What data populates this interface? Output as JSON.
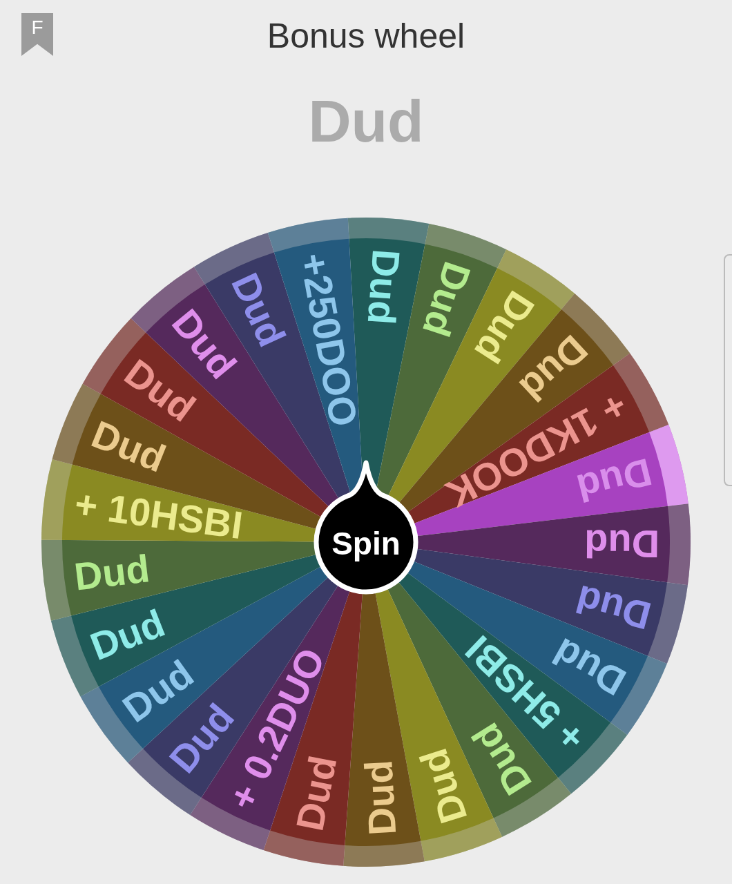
{
  "header": {
    "badge": "F",
    "title": "Bonus wheel"
  },
  "result": "Dud",
  "wheel": {
    "button": "Spin",
    "segments": [
      {
        "label": "Dud",
        "color": "#1f5a58",
        "selected": false
      },
      {
        "label": "Dud",
        "color": "#4d6a3a",
        "selected": false
      },
      {
        "label": "Dud",
        "color": "#8a8a22",
        "selected": false
      },
      {
        "label": "Dud",
        "color": "#6d5019",
        "selected": false
      },
      {
        "label": "+ 1KDOOK",
        "color": "#7a2a24",
        "selected": false
      },
      {
        "label": "Dud",
        "color": "#a742c0",
        "selected": true
      },
      {
        "label": "Dud",
        "color": "#55295c",
        "selected": false
      },
      {
        "label": "Dud",
        "color": "#3a3a66",
        "selected": false
      },
      {
        "label": "Dud",
        "color": "#245a7e",
        "selected": false
      },
      {
        "label": "+ 5HSBI",
        "color": "#1f5a58",
        "selected": false
      },
      {
        "label": "Dud",
        "color": "#4d6a3a",
        "selected": false
      },
      {
        "label": "Dud",
        "color": "#8a8a22",
        "selected": false
      },
      {
        "label": "Dud",
        "color": "#6d5019",
        "selected": false
      },
      {
        "label": "Dud",
        "color": "#7a2a24",
        "selected": false
      },
      {
        "label": "+ 0.2DUO",
        "color": "#55295c",
        "selected": false
      },
      {
        "label": "Dud",
        "color": "#3a3a66",
        "selected": false
      },
      {
        "label": "Dud",
        "color": "#245a7e",
        "selected": false
      },
      {
        "label": "Dud",
        "color": "#1f5a58",
        "selected": false
      },
      {
        "label": "Dud",
        "color": "#4d6a3a",
        "selected": false
      },
      {
        "label": "+ 10HSBI",
        "color": "#8a8a22",
        "selected": false
      },
      {
        "label": "Dud",
        "color": "#6d5019",
        "selected": false
      },
      {
        "label": "Dud",
        "color": "#7a2a24",
        "selected": false
      },
      {
        "label": "Dud",
        "color": "#55295c",
        "selected": false
      },
      {
        "label": "Dud",
        "color": "#3a3a66",
        "selected": false
      },
      {
        "label": "+250DOO",
        "color": "#245a7e",
        "selected": false
      }
    ]
  }
}
